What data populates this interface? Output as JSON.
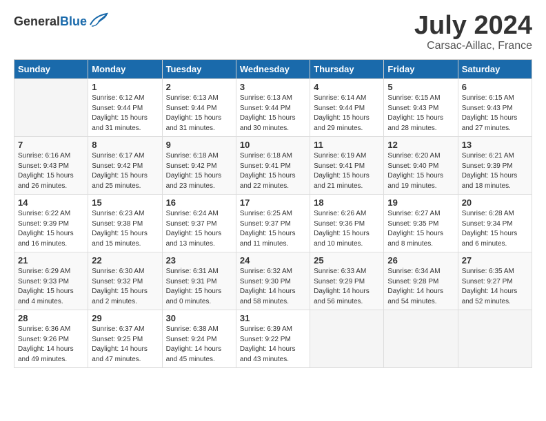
{
  "header": {
    "logo_general": "General",
    "logo_blue": "Blue",
    "month": "July 2024",
    "location": "Carsac-Aillac, France"
  },
  "weekdays": [
    "Sunday",
    "Monday",
    "Tuesday",
    "Wednesday",
    "Thursday",
    "Friday",
    "Saturday"
  ],
  "weeks": [
    [
      {
        "day": "",
        "text": ""
      },
      {
        "day": "1",
        "text": "Sunrise: 6:12 AM\nSunset: 9:44 PM\nDaylight: 15 hours\nand 31 minutes."
      },
      {
        "day": "2",
        "text": "Sunrise: 6:13 AM\nSunset: 9:44 PM\nDaylight: 15 hours\nand 31 minutes."
      },
      {
        "day": "3",
        "text": "Sunrise: 6:13 AM\nSunset: 9:44 PM\nDaylight: 15 hours\nand 30 minutes."
      },
      {
        "day": "4",
        "text": "Sunrise: 6:14 AM\nSunset: 9:44 PM\nDaylight: 15 hours\nand 29 minutes."
      },
      {
        "day": "5",
        "text": "Sunrise: 6:15 AM\nSunset: 9:43 PM\nDaylight: 15 hours\nand 28 minutes."
      },
      {
        "day": "6",
        "text": "Sunrise: 6:15 AM\nSunset: 9:43 PM\nDaylight: 15 hours\nand 27 minutes."
      }
    ],
    [
      {
        "day": "7",
        "text": "Sunrise: 6:16 AM\nSunset: 9:43 PM\nDaylight: 15 hours\nand 26 minutes."
      },
      {
        "day": "8",
        "text": "Sunrise: 6:17 AM\nSunset: 9:42 PM\nDaylight: 15 hours\nand 25 minutes."
      },
      {
        "day": "9",
        "text": "Sunrise: 6:18 AM\nSunset: 9:42 PM\nDaylight: 15 hours\nand 23 minutes."
      },
      {
        "day": "10",
        "text": "Sunrise: 6:18 AM\nSunset: 9:41 PM\nDaylight: 15 hours\nand 22 minutes."
      },
      {
        "day": "11",
        "text": "Sunrise: 6:19 AM\nSunset: 9:41 PM\nDaylight: 15 hours\nand 21 minutes."
      },
      {
        "day": "12",
        "text": "Sunrise: 6:20 AM\nSunset: 9:40 PM\nDaylight: 15 hours\nand 19 minutes."
      },
      {
        "day": "13",
        "text": "Sunrise: 6:21 AM\nSunset: 9:39 PM\nDaylight: 15 hours\nand 18 minutes."
      }
    ],
    [
      {
        "day": "14",
        "text": "Sunrise: 6:22 AM\nSunset: 9:39 PM\nDaylight: 15 hours\nand 16 minutes."
      },
      {
        "day": "15",
        "text": "Sunrise: 6:23 AM\nSunset: 9:38 PM\nDaylight: 15 hours\nand 15 minutes."
      },
      {
        "day": "16",
        "text": "Sunrise: 6:24 AM\nSunset: 9:37 PM\nDaylight: 15 hours\nand 13 minutes."
      },
      {
        "day": "17",
        "text": "Sunrise: 6:25 AM\nSunset: 9:37 PM\nDaylight: 15 hours\nand 11 minutes."
      },
      {
        "day": "18",
        "text": "Sunrise: 6:26 AM\nSunset: 9:36 PM\nDaylight: 15 hours\nand 10 minutes."
      },
      {
        "day": "19",
        "text": "Sunrise: 6:27 AM\nSunset: 9:35 PM\nDaylight: 15 hours\nand 8 minutes."
      },
      {
        "day": "20",
        "text": "Sunrise: 6:28 AM\nSunset: 9:34 PM\nDaylight: 15 hours\nand 6 minutes."
      }
    ],
    [
      {
        "day": "21",
        "text": "Sunrise: 6:29 AM\nSunset: 9:33 PM\nDaylight: 15 hours\nand 4 minutes."
      },
      {
        "day": "22",
        "text": "Sunrise: 6:30 AM\nSunset: 9:32 PM\nDaylight: 15 hours\nand 2 minutes."
      },
      {
        "day": "23",
        "text": "Sunrise: 6:31 AM\nSunset: 9:31 PM\nDaylight: 15 hours\nand 0 minutes."
      },
      {
        "day": "24",
        "text": "Sunrise: 6:32 AM\nSunset: 9:30 PM\nDaylight: 14 hours\nand 58 minutes."
      },
      {
        "day": "25",
        "text": "Sunrise: 6:33 AM\nSunset: 9:29 PM\nDaylight: 14 hours\nand 56 minutes."
      },
      {
        "day": "26",
        "text": "Sunrise: 6:34 AM\nSunset: 9:28 PM\nDaylight: 14 hours\nand 54 minutes."
      },
      {
        "day": "27",
        "text": "Sunrise: 6:35 AM\nSunset: 9:27 PM\nDaylight: 14 hours\nand 52 minutes."
      }
    ],
    [
      {
        "day": "28",
        "text": "Sunrise: 6:36 AM\nSunset: 9:26 PM\nDaylight: 14 hours\nand 49 minutes."
      },
      {
        "day": "29",
        "text": "Sunrise: 6:37 AM\nSunset: 9:25 PM\nDaylight: 14 hours\nand 47 minutes."
      },
      {
        "day": "30",
        "text": "Sunrise: 6:38 AM\nSunset: 9:24 PM\nDaylight: 14 hours\nand 45 minutes."
      },
      {
        "day": "31",
        "text": "Sunrise: 6:39 AM\nSunset: 9:22 PM\nDaylight: 14 hours\nand 43 minutes."
      },
      {
        "day": "",
        "text": ""
      },
      {
        "day": "",
        "text": ""
      },
      {
        "day": "",
        "text": ""
      }
    ]
  ]
}
